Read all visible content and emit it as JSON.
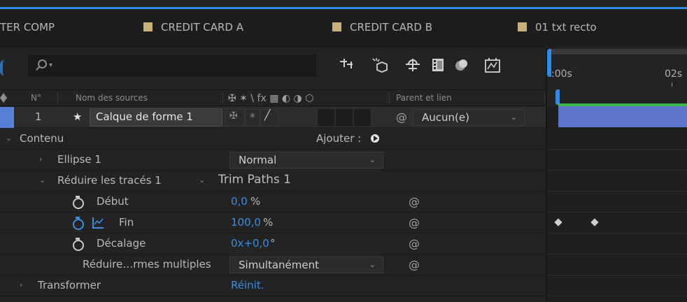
{
  "tabs": [
    {
      "label": "TER COMP",
      "has_swatch": false
    },
    {
      "label": "CREDIT CARD A",
      "has_swatch": true
    },
    {
      "label": "CREDIT CARD B",
      "has_swatch": true
    },
    {
      "label": "01 txt recto",
      "has_swatch": true
    }
  ],
  "search": {
    "placeholder": ""
  },
  "toolbar": {
    "icons": [
      "draft-3d-icon",
      "shy-layers-icon",
      "frame-blending-icon",
      "motion-blur-icon",
      "graph-editor-icon",
      "timeline-navigator-icon"
    ]
  },
  "header": {
    "num": "N°",
    "source_name": "Nom des sources",
    "switches": "✠ ✶ \\ fx ▦ ◐ ◑ ⬡",
    "parent": "Parent et lien"
  },
  "layer": {
    "number": "1",
    "star": "★",
    "name": "Calque de forme 1",
    "parent_value": "Aucun(e)"
  },
  "rows": {
    "contenu": "Contenu",
    "ajouter": "Ajouter :",
    "ellipse": "Ellipse 1",
    "ellipse_mode": "Normal",
    "reduire": "Réduire les tracés 1",
    "trim_paths": "Trim Paths 1",
    "debut": "Début",
    "debut_value": "0,0",
    "debut_unit": "%",
    "fin": "Fin",
    "fin_value": "100,0",
    "fin_unit": "%",
    "decalage": "Décalage",
    "decalage_value": "0x+0,0",
    "decalage_unit": "°",
    "multiple": "Réduire…rmes multiples",
    "multiple_value": "Simultanément",
    "transformer": "Transformer",
    "reinit": "Réinit."
  },
  "timeline": {
    "ruler_start": ":00s",
    "ruler_2s": "02s"
  },
  "colors": {
    "accent_blue": "#2d8ceb",
    "tab_swatch": "#c7b07a",
    "layer_bar": "#5c74cc",
    "work_area": "#39b54a"
  }
}
